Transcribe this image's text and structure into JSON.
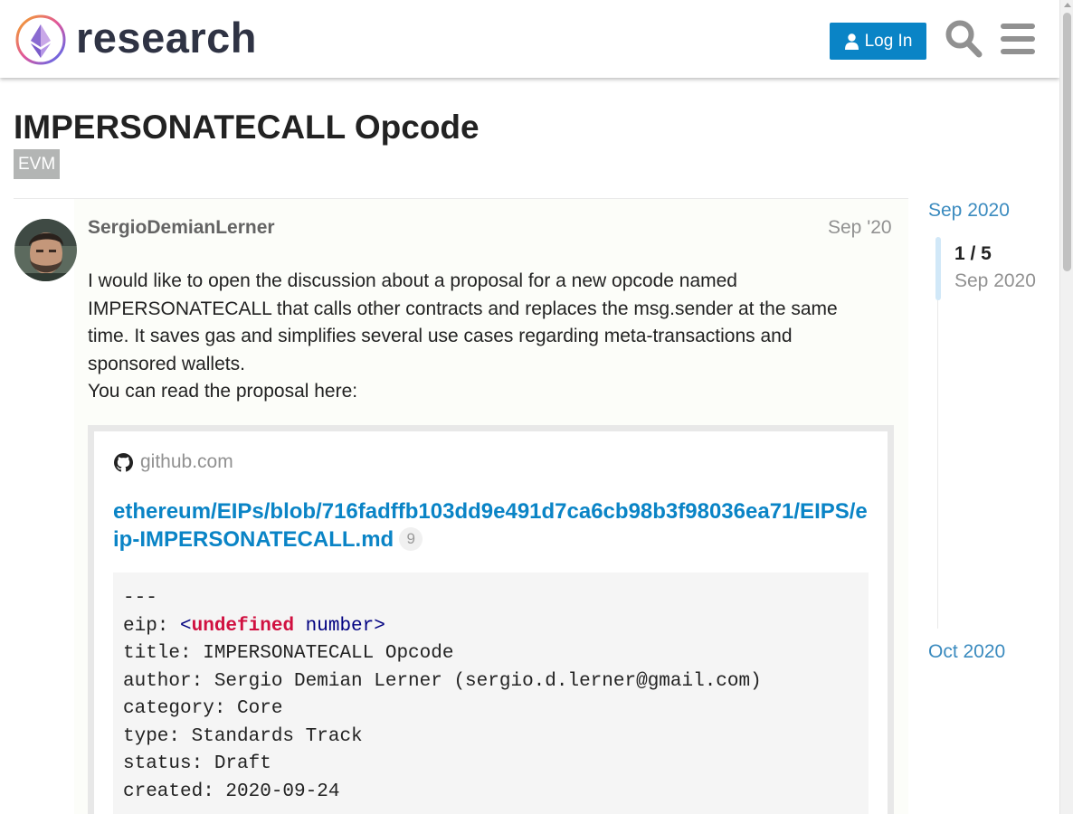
{
  "header": {
    "logo_text": "research",
    "login_label": "Log In",
    "brand_color": "#0a84c6",
    "icons": [
      "ethereum-logo-icon",
      "user-icon",
      "search-icon",
      "hamburger-menu-icon"
    ]
  },
  "topic": {
    "title": "IMPERSONATECALL Opcode",
    "category": "EVM"
  },
  "post": {
    "username": "SergioDemianLerner",
    "date": "Sep '20",
    "paragraphs": [
      "I would like to open the discussion about a proposal for a new opcode named IMPERSONATECALL that calls other contracts and replaces the msg.sender at the same time. It saves gas and simplifies several use cases regarding meta-transactions and sponsored wallets.",
      "You can read the proposal here:"
    ],
    "onebox": {
      "source": "github.com",
      "link_text": "ethereum/EIPs/blob/716fadffb103dd9e491d7ca6cb98b3f98036ea71/EIPS/eip-IMPERSONATECALL.md",
      "click_count": "9",
      "code": {
        "line1": "---",
        "eip_key": "eip: ",
        "eip_open": "<",
        "eip_tag": "undefined",
        "eip_attr": " number",
        "eip_close": ">",
        "line3": "title: IMPERSONATECALL Opcode",
        "line4": "author: Sergio Demian Lerner (sergio.d.lerner@gmail.com)",
        "line5": "category: Core",
        "line6": "type: Standards Track",
        "line7": "status: Draft",
        "line8": "created: 2020-09-24"
      }
    }
  },
  "timeline": {
    "start_label": "Sep 2020",
    "position": "1 / 5",
    "current_date": "Sep 2020",
    "end_label": "Oct 2020"
  }
}
